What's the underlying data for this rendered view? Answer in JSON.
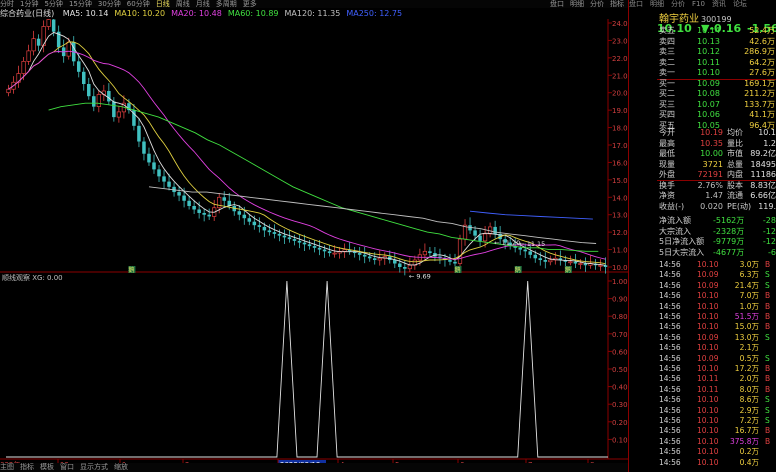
{
  "top_bar": {
    "left_items": [
      "分时",
      "1分钟",
      "5分钟",
      "15分钟",
      "30分钟",
      "60分钟",
      "日线",
      "周线",
      "月线",
      "多周期",
      "更多"
    ],
    "active": "日线",
    "right_items": [
      "盘口",
      "明细",
      "分价",
      "指标"
    ]
  },
  "ma_line": {
    "prefix": "综合药业(日线)",
    "items": [
      {
        "text": "MA5: 10.14",
        "color": "#e0e0e0"
      },
      {
        "text": "MA10: 10.20",
        "color": "#e0d040"
      },
      {
        "text": "MA20: 10.48",
        "color": "#e040e0"
      },
      {
        "text": "MA60: 10.89",
        "color": "#40e040"
      },
      {
        "text": "MA120: 11.35",
        "color": "#c0c0c0"
      },
      {
        "text": "MA250: 12.75",
        "color": "#4060ff"
      }
    ]
  },
  "price_chart": {
    "y_ticks": [
      "24.00",
      "23.00",
      "22.00",
      "21.00",
      "20.00",
      "19.00",
      "18.00",
      "17.00",
      "16.00",
      "15.00",
      "14.00",
      "13.00",
      "12.00",
      "11.00",
      "10.00"
    ],
    "y_min": 10.0,
    "y_max": 24.0,
    "annotations": [
      "24.44",
      "9.69",
      "11.20",
      "11.15"
    ],
    "markers": [
      "鹅",
      "鹅",
      "鹅",
      "鹅"
    ],
    "close": [
      20.2,
      20.6,
      21.1,
      21.8,
      22.4,
      23.1,
      22.7,
      23.8,
      24.2,
      23.5,
      22.6,
      22.1,
      22.9,
      21.8,
      21.2,
      20.5,
      19.8,
      19.2,
      19.9,
      20.1,
      19.5,
      18.6,
      18.9,
      19.4,
      19.0,
      18.1,
      17.2,
      16.5,
      16.0,
      15.6,
      15.2,
      14.9,
      14.6,
      14.3,
      14.1,
      13.8,
      13.5,
      13.3,
      13.1,
      13.0,
      12.9,
      13.4,
      14.0,
      13.8,
      13.5,
      13.2,
      13.0,
      12.8,
      12.6,
      12.4,
      12.3,
      12.1,
      12.0,
      11.9,
      11.8,
      11.7,
      11.6,
      11.5,
      11.4,
      11.3,
      11.2,
      11.1,
      11.0,
      10.9,
      10.8,
      10.8,
      10.9,
      11.0,
      10.9,
      10.8,
      10.7,
      10.6,
      10.5,
      10.4,
      10.5,
      10.6,
      10.4,
      10.2,
      10.0,
      9.9,
      10.1,
      10.4,
      10.7,
      10.9,
      10.8,
      10.6,
      10.5,
      10.4,
      10.3,
      10.2,
      11.6,
      12.4,
      12.1,
      11.8,
      11.5,
      11.9,
      12.3,
      11.9,
      11.6,
      11.4,
      11.2,
      11.1,
      11.0,
      10.9,
      10.7,
      10.5,
      10.4,
      10.3,
      10.4,
      10.5,
      10.4,
      10.3,
      10.3,
      10.2,
      10.2,
      10.1,
      10.2,
      10.1,
      10.1,
      10.0
    ],
    "ma60": [
      19.0,
      19.2,
      19.3,
      19.4,
      19.4,
      19.3,
      19.2,
      19.0,
      18.8,
      18.6,
      18.3,
      18.0,
      17.7,
      17.3,
      17.0,
      16.6,
      16.2,
      15.8,
      15.4,
      15.0,
      14.6,
      14.3,
      14.0,
      13.7,
      13.4,
      13.2,
      13.0,
      12.8,
      12.6,
      12.4,
      12.2,
      12.0,
      11.9,
      11.7,
      11.6,
      11.5,
      11.4,
      11.3,
      11.2,
      11.1,
      11.1,
      11.0,
      11.0,
      10.95,
      10.9,
      10.9
    ],
    "ma120": [
      14.6,
      14.5,
      14.4,
      14.3,
      14.3,
      14.2,
      14.1,
      14.0,
      13.9,
      13.8,
      13.7,
      13.6,
      13.5,
      13.4,
      13.3,
      13.2,
      13.1,
      13.0,
      12.9,
      12.8,
      12.6,
      12.5,
      12.3,
      12.2,
      12.0,
      11.9,
      11.8,
      11.7,
      11.6,
      11.5,
      11.4,
      11.35
    ],
    "ma250": [
      13.2,
      13.1,
      13.0,
      12.95,
      12.9,
      12.85,
      12.8,
      12.75
    ]
  },
  "indicator": {
    "title": "顺线观察  XG: 0.00",
    "y_ticks": [
      "1.00",
      "0.90",
      "0.80",
      "0.70",
      "0.60",
      "0.50",
      "0.40",
      "0.30",
      "0.20",
      "0.10"
    ],
    "spikes_at": [
      28,
      32,
      52
    ],
    "total_bars": 60
  },
  "x_axis": {
    "labels": [
      "022年",
      "12",
      "1",
      "2",
      "2023/03/13",
      "4",
      "5",
      "6",
      "7",
      "8"
    ]
  },
  "bottom_bar": {
    "items": [
      "主图",
      "指标",
      "模板",
      "窗口",
      "显示方式",
      "缩放"
    ]
  },
  "right_panel": {
    "tabs": [
      "盘口",
      "明细",
      "分价",
      "F10",
      "资讯",
      "论坛"
    ],
    "stock_name": "翰宇药业",
    "stock_code": "300199",
    "price": "10.10",
    "change": "▼-0.16",
    "change_pct": "-1.56%",
    "order_book": [
      {
        "label": "卖五",
        "price": "10.14",
        "vol": "52.4万"
      },
      {
        "label": "卖四",
        "price": "10.13",
        "vol": "42.6万"
      },
      {
        "label": "卖三",
        "price": "10.12",
        "vol": "286.9万"
      },
      {
        "label": "卖二",
        "price": "10.11",
        "vol": "64.2万"
      },
      {
        "label": "卖一",
        "price": "10.10",
        "vol": "27.6万"
      },
      {
        "label": "买一",
        "price": "10.09",
        "vol": "169.1万"
      },
      {
        "label": "买二",
        "price": "10.08",
        "vol": "211.2万"
      },
      {
        "label": "买三",
        "price": "10.07",
        "vol": "133.7万"
      },
      {
        "label": "买四",
        "price": "10.06",
        "vol": "41.1万"
      },
      {
        "label": "买五",
        "price": "10.05",
        "vol": "96.4万"
      }
    ],
    "stats": [
      {
        "l1": "今开",
        "v1": "10.19",
        "c1": "#e04040",
        "l2": "均价",
        "v2": "10.1"
      },
      {
        "l1": "最高",
        "v1": "10.35",
        "c1": "#e04040",
        "l2": "量比",
        "v2": "1.2"
      },
      {
        "l1": "最低",
        "v1": "10.00",
        "c1": "#40e040",
        "l2": "市值",
        "v2": "89.2亿"
      },
      {
        "l1": "现量",
        "v1": "3721",
        "c1": "#f0d040",
        "l2": "总量",
        "v2": "18495"
      },
      {
        "l1": "外盘",
        "v1": "72191",
        "c1": "#e04040",
        "l2": "内盘",
        "v2": "11186"
      },
      {
        "l1": "换手",
        "v1": "2.76%",
        "c1": "#c0c0c0",
        "l2": "股本",
        "v2": "8.83亿"
      },
      {
        "l1": "净资",
        "v1": "1.47",
        "c1": "#c0c0c0",
        "l2": "流通",
        "v2": "6.66亿"
      },
      {
        "l1": "收益(-)",
        "v1": "0.020",
        "c1": "#c0c0c0",
        "l2": "PE(动)",
        "v2": "119."
      }
    ],
    "flows": [
      {
        "label": "净流入额",
        "v1": "-5162万",
        "v2": "-28"
      },
      {
        "label": "大宗流入",
        "v1": "-2328万",
        "v2": "-12"
      },
      {
        "label": "5日净流入额",
        "v1": "-9779万",
        "v2": "-12"
      },
      {
        "label": "5日大宗流入",
        "v1": "-4677万",
        "v2": "-6"
      }
    ],
    "ticks": [
      {
        "t": "14:56",
        "p": "10.10",
        "pc": "#e04040",
        "v": "3.0万",
        "vc": "#f0d040",
        "s": "B"
      },
      {
        "t": "14:56",
        "p": "10.09",
        "pc": "#e04040",
        "v": "6.3万",
        "vc": "#f0d040",
        "s": "S"
      },
      {
        "t": "14:56",
        "p": "10.09",
        "pc": "#e04040",
        "v": "21.4万",
        "vc": "#f0d040",
        "s": "S"
      },
      {
        "t": "14:56",
        "p": "10.10",
        "pc": "#e04040",
        "v": "7.0万",
        "vc": "#f0d040",
        "s": "B"
      },
      {
        "t": "14:56",
        "p": "10.10",
        "pc": "#e04040",
        "v": "1.0万",
        "vc": "#f0d040",
        "s": "B"
      },
      {
        "t": "14:56",
        "p": "10.10",
        "pc": "#e04040",
        "v": "51.5万",
        "vc": "#e040e0",
        "s": "B"
      },
      {
        "t": "14:56",
        "p": "10.10",
        "pc": "#e04040",
        "v": "15.0万",
        "vc": "#f0d040",
        "s": "B"
      },
      {
        "t": "14:56",
        "p": "10.09",
        "pc": "#e04040",
        "v": "13.0万",
        "vc": "#f0d040",
        "s": "S"
      },
      {
        "t": "14:56",
        "p": "10.10",
        "pc": "#e04040",
        "v": "2.1万",
        "vc": "#f0d040",
        "s": ""
      },
      {
        "t": "14:56",
        "p": "10.09",
        "pc": "#e04040",
        "v": "0.5万",
        "vc": "#f0d040",
        "s": "S"
      },
      {
        "t": "14:56",
        "p": "10.10",
        "pc": "#e04040",
        "v": "17.2万",
        "vc": "#f0d040",
        "s": "B"
      },
      {
        "t": "14:56",
        "p": "10.11",
        "pc": "#e04040",
        "v": "2.0万",
        "vc": "#f0d040",
        "s": "B"
      },
      {
        "t": "14:56",
        "p": "10.11",
        "pc": "#e04040",
        "v": "8.0万",
        "vc": "#f0d040",
        "s": "B"
      },
      {
        "t": "14:56",
        "p": "10.10",
        "pc": "#e04040",
        "v": "8.6万",
        "vc": "#f0d040",
        "s": "S"
      },
      {
        "t": "14:56",
        "p": "10.10",
        "pc": "#e04040",
        "v": "2.9万",
        "vc": "#f0d040",
        "s": "S"
      },
      {
        "t": "14:56",
        "p": "10.10",
        "pc": "#e04040",
        "v": "7.2万",
        "vc": "#f0d040",
        "s": "S"
      },
      {
        "t": "14:56",
        "p": "10.10",
        "pc": "#e04040",
        "v": "16.7万",
        "vc": "#f0d040",
        "s": "B"
      },
      {
        "t": "14:56",
        "p": "10.10",
        "pc": "#e04040",
        "v": "375.8万",
        "vc": "#e040e0",
        "s": "B"
      },
      {
        "t": "14:56",
        "p": "10.10",
        "pc": "#e04040",
        "v": "0.2万",
        "vc": "#f0d040",
        "s": ""
      },
      {
        "t": "14:56",
        "p": "10.10",
        "pc": "#e04040",
        "v": "0.4万",
        "vc": "#f0d040",
        "s": ""
      }
    ]
  }
}
